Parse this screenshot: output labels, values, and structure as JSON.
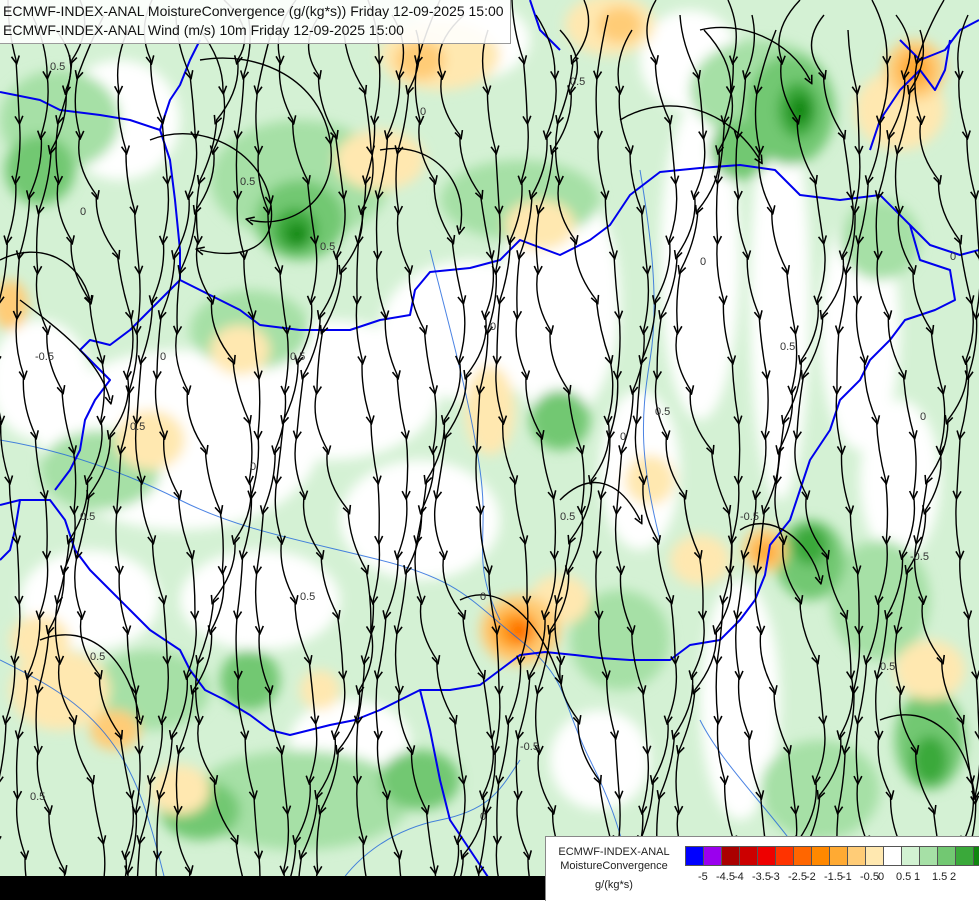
{
  "title": {
    "line1": "ECMWF-INDEX-ANAL MoistureConvergence (g/(kg*s)) Friday 12-09-2025 15:00",
    "line2": "ECMWF-INDEX-ANAL Wind (m/s) 10m Friday 12-09-2025 15:00"
  },
  "legend": {
    "name_line1": "ECMWF-INDEX-ANAL",
    "name_line2": "MoistureConvergence",
    "unit": "g/(kg*s)",
    "colors": [
      "#0000ff",
      "#9a00ee",
      "#aa0000",
      "#cc0000",
      "#ee0000",
      "#ff3300",
      "#ff6600",
      "#ff8800",
      "#ffaa33",
      "#ffcc77",
      "#ffe8b0",
      "#ffffff",
      "#d2f2d2",
      "#a6e0a6",
      "#72c872",
      "#3aa93a",
      "#0f860f"
    ],
    "ticks": [
      "-5",
      "-4.5",
      "-4",
      "-3.5",
      "-3",
      "-2.5",
      "-2",
      "-1.5",
      "-1",
      "-0.5",
      "0",
      "0.5",
      "1",
      "1.5",
      "2"
    ]
  },
  "contour_labels": [
    "0",
    "0.5",
    "-0.5"
  ],
  "colors": {
    "border": "#0000ee",
    "river": "#1e64dc",
    "streamline": "#000000"
  }
}
